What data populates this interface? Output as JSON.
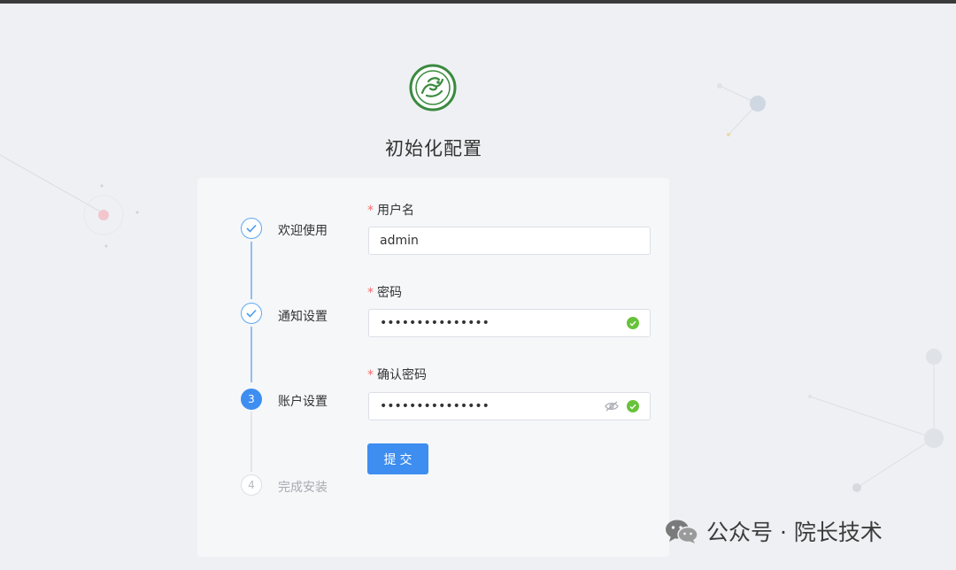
{
  "page": {
    "title": "初始化配置"
  },
  "steps": [
    {
      "label": "欢迎使用",
      "status": "done",
      "marker": "✓"
    },
    {
      "label": "通知设置",
      "status": "done",
      "marker": "✓"
    },
    {
      "label": "账户设置",
      "status": "active",
      "marker": "3"
    },
    {
      "label": "完成安装",
      "status": "pending",
      "marker": "4"
    }
  ],
  "form": {
    "username": {
      "label": "用户名",
      "required_mark": "*",
      "value": "admin"
    },
    "password": {
      "label": "密码",
      "required_mark": "*",
      "value": "•••••••••••••••"
    },
    "confirm_password": {
      "label": "确认密码",
      "required_mark": "*",
      "value": "•••••••••••••••"
    },
    "submit_label": "提交"
  },
  "watermark": {
    "text": "公众号 · 院长技术"
  },
  "colors": {
    "primary": "#3d8ef0",
    "success": "#67c23a",
    "required": "#f56c6c",
    "step_done": "#5da8f0"
  },
  "icons": {
    "logo": "dragon-emblem-icon",
    "done_step": "check-icon",
    "valid": "check-circle-icon",
    "toggle_visibility": "eye-off-icon",
    "watermark": "wechat-icon"
  }
}
